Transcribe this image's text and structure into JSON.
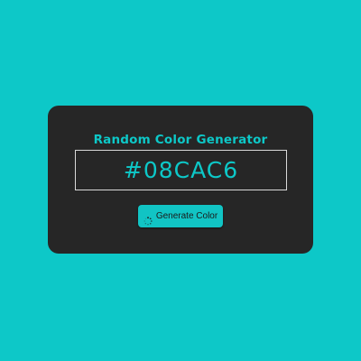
{
  "colors": {
    "background": "#0dc8c8",
    "card": "#262626",
    "accent": "#0dc8c8",
    "button": "#11c4c4",
    "button_text": "#1a1a1a",
    "box_border": "#d9d9d9"
  },
  "card": {
    "title": "Random Color Generator",
    "hex_value": "#08CAC6",
    "button": {
      "label": "Generate Color",
      "icon": "spinner-icon"
    }
  }
}
